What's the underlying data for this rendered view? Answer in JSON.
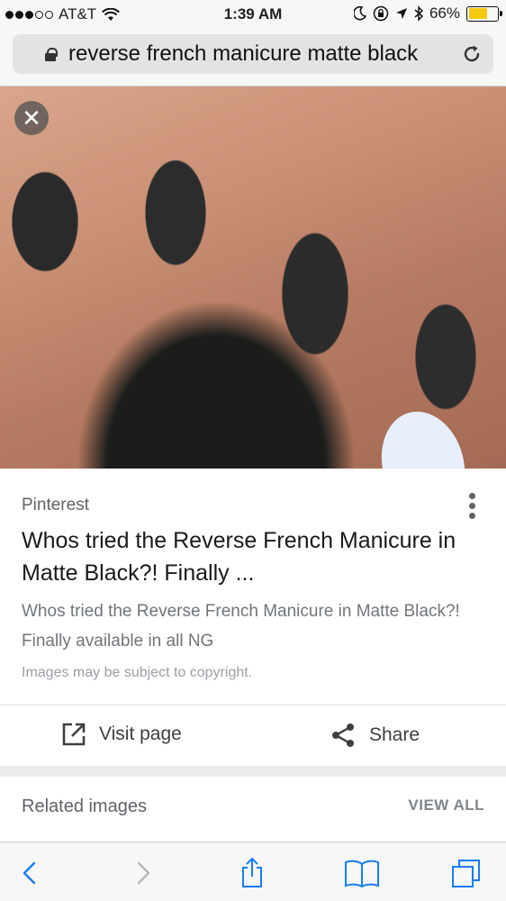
{
  "status": {
    "carrier": "AT&T",
    "time": "1:39 AM",
    "battery": "66%",
    "signal_bars_filled": 3,
    "signal_bars_total": 5
  },
  "urlbar": {
    "query": "reverse french manicure matte black"
  },
  "result": {
    "source": "Pinterest",
    "title": "Whos tried the Reverse French Manicure in Matte Black?! Finally ...",
    "description": "Whos tried the Reverse French Manicure in Matte Black?! Finally available in all NG",
    "copyright": "Images may be subject to copyright.",
    "visit_label": "Visit page",
    "share_label": "Share"
  },
  "related": {
    "label": "Related images",
    "view_all": "VIEW ALL"
  },
  "colors": {
    "battery": "#f6c90e",
    "accent_blue": "#1a73e8",
    "ios_blue": "#1a7cf5"
  },
  "icons": [
    "lock-icon",
    "reload-icon",
    "close-icon",
    "more-icon",
    "open-external-icon",
    "share-icon",
    "back-icon",
    "forward-icon",
    "share-sheet-icon",
    "bookmarks-icon",
    "tabs-icon"
  ]
}
